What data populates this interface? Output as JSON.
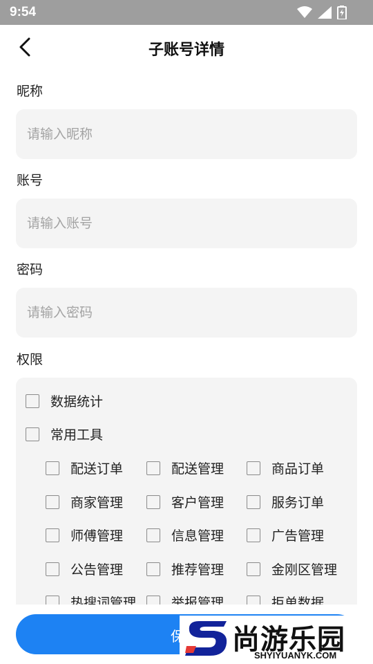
{
  "status_bar": {
    "time": "9:54"
  },
  "header": {
    "title": "子账号详情"
  },
  "form": {
    "nickname": {
      "label": "昵称",
      "placeholder": "请输入昵称"
    },
    "account": {
      "label": "账号",
      "placeholder": "请输入账号"
    },
    "password": {
      "label": "密码",
      "placeholder": "请输入密码"
    }
  },
  "permissions": {
    "label": "权限",
    "top_level": [
      "数据统计",
      "常用工具"
    ],
    "tools": [
      [
        "配送订单",
        "配送管理",
        "商品订单"
      ],
      [
        "商家管理",
        "客户管理",
        "服务订单"
      ],
      [
        "师傅管理",
        "信息管理",
        "广告管理"
      ],
      [
        "公告管理",
        "推荐管理",
        "金刚区管理"
      ],
      [
        "热搜词管理",
        "举报管理",
        "拒单数据"
      ]
    ]
  },
  "footer": {
    "save_label": "保存"
  },
  "watermark": {
    "title": "尚游乐园",
    "url": "SHYIYUANYK.COM"
  },
  "colors": {
    "accent": "#1d82f3",
    "status_bar": "#9e9e9e",
    "input_bg": "#f4f4f4"
  }
}
